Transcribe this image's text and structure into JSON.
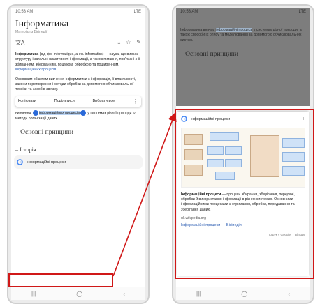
{
  "colors": {
    "highlight": "#b9d3f3",
    "handle": "#2a69d8",
    "annotation": "#d01818",
    "link": "#2e5fb3"
  },
  "left": {
    "status_time": "10:53 AM",
    "status_right": "LTE",
    "page_title": "Інформатика",
    "page_subtitle": "Матеріал з Вікіпедії",
    "tool_left": "文A",
    "tool_icons": [
      "download-icon",
      "star-icon",
      "edit-icon"
    ],
    "tool_download": "⤓",
    "tool_star": "☆",
    "tool_edit": "✎",
    "para1_lead": "Інформатика",
    "para1": " (від фр. informatique, англ. informatics) — наука, що вивчає структуру і загальні властивості інформації, а також питання, пов'язані з її збиранням, зберіганням, пошуком, обробкою та поширенням.",
    "para1_link": "інформаційних процесів",
    "para2": "Основним об'єктом вивчення інформатики є інформація, її властивості, закони перетворення і методи обробки за допомогою обчислювальної техніки та засобів зв'язку.",
    "toolbar": {
      "copy": "Копіювати",
      "share": "Поділитися",
      "select_all": "Вибрати все",
      "more": "⋮"
    },
    "para3_pre": "вивчення ",
    "para3_sel": "інформаційних процесів",
    "para3_post": " у системах різної природи та методи організації даних.",
    "section1": "Основні принципи",
    "section2": "Історія",
    "search_chip": "інформаційні процеси",
    "nav": [
      "|||",
      "◯",
      "‹"
    ]
  },
  "right": {
    "status_time": "10:53 AM",
    "status_right": "LTE",
    "bg_para_pre": "Інформатика вивчає ",
    "bg_para_sel": "інформаційні процеси",
    "bg_para_post": " у системах різної природи, а також способи їх опису та моделювання за допомогою обчислювальних систем.",
    "bg_section": "Основні принципи",
    "card_query": "інформаційні процеси",
    "card_more": "⋮",
    "kp_title": "Інформаційні процеси",
    "kp_text": " — процеси збирання, зберігання, передачі, обробки й використання інформації в різних системах. Основними інформаційними процесами є отримання, обробка, передавання та зберігання даних.",
    "kp_source": "uk.wikipedia.org",
    "kp_link": "Інформаційні процеси — Вікіпедія",
    "card_bottom_left": "Пошук у Google",
    "card_bottom_right": "Більше",
    "nav": [
      "|||",
      "◯",
      "‹"
    ]
  }
}
